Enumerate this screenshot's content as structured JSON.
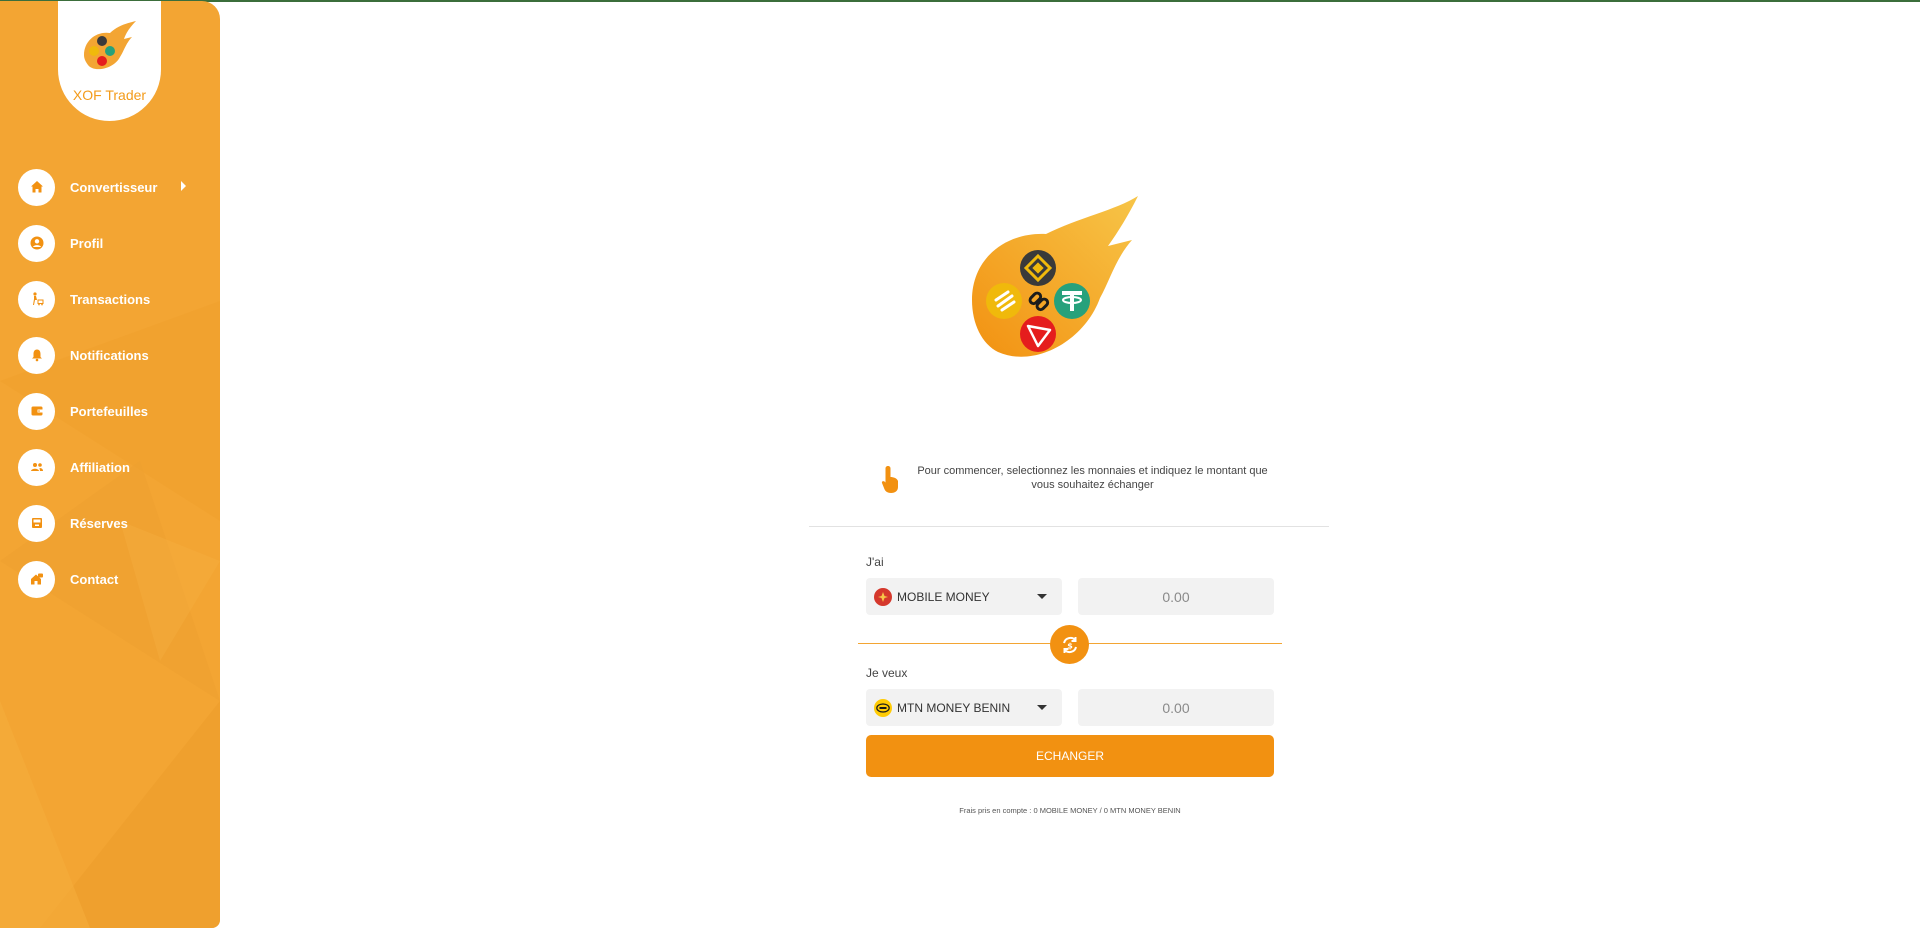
{
  "brand": {
    "name": "XOF Trader"
  },
  "colors": {
    "sidebar": "#f3a533",
    "accent": "#f29111",
    "field_bg": "#f2f2f2"
  },
  "sidebar": {
    "items": [
      {
        "label": "Convertisseur",
        "icon": "home-icon",
        "has_submenu": true
      },
      {
        "label": "Profil",
        "icon": "user-icon"
      },
      {
        "label": "Transactions",
        "icon": "person-cart-icon"
      },
      {
        "label": "Notifications",
        "icon": "bell-icon"
      },
      {
        "label": "Portefeuilles",
        "icon": "wallet-icon"
      },
      {
        "label": "Affiliation",
        "icon": "people-icon"
      },
      {
        "label": "Réserves",
        "icon": "inbox-icon"
      },
      {
        "label": "Contact",
        "icon": "house-chat-icon"
      }
    ]
  },
  "hint": {
    "text": "Pour commencer, selectionnez les monnaies et indiquez le montant que vous souhaitez échanger",
    "icon": "hand-pointer-icon"
  },
  "exchange": {
    "from": {
      "label": "J'ai",
      "currency": "MOBILE MONEY",
      "amount_placeholder": "0.00"
    },
    "to": {
      "label": "Je veux",
      "currency": "MTN MONEY BENIN",
      "amount_placeholder": "0.00"
    },
    "submit_label": "ECHANGER",
    "fees_text": "Frais pris en compte : 0 MOBILE MONEY / 0 MTN MONEY BENIN"
  }
}
